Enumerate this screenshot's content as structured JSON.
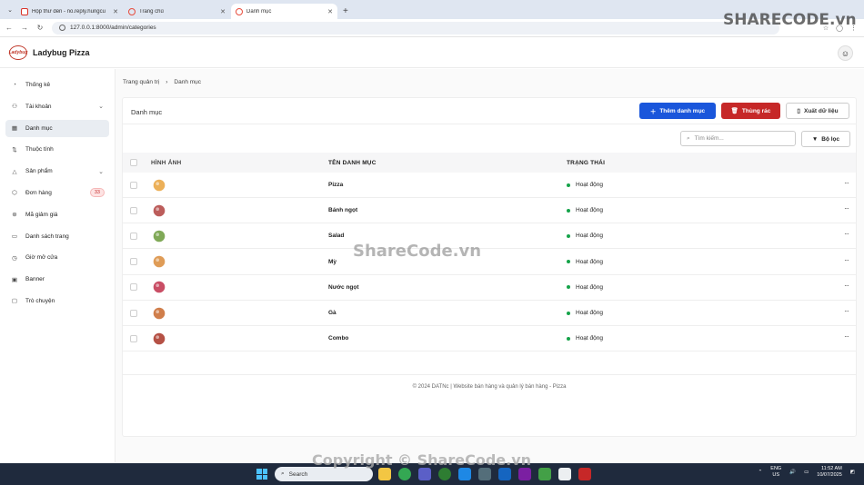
{
  "browser": {
    "tabs": [
      {
        "title": "Hộp thư đến - no.reply.hungcu",
        "favicon_color": "#d93025",
        "active": false
      },
      {
        "title": "Trang chủ",
        "favicon_color": "#e74c3c",
        "active": false
      },
      {
        "title": "Danh mục",
        "favicon_color": "#e74c3c",
        "active": true
      }
    ],
    "new_tab": "+",
    "url": "127.0.0.1:8000/admin/categories"
  },
  "app": {
    "brand": "Ladybug Pizza",
    "logo_text": "Ladybug"
  },
  "sidebar": {
    "items": [
      {
        "label": "Thống kê",
        "icon": "chart-pie-icon",
        "glyph": "◔"
      },
      {
        "label": "Tài khoản",
        "icon": "user-icon",
        "glyph": "⚇",
        "chevron": "⌄"
      },
      {
        "label": "Danh mục",
        "icon": "grid-icon",
        "glyph": "▦",
        "active": true
      },
      {
        "label": "Thuộc tính",
        "icon": "sort-icon",
        "glyph": "⇅"
      },
      {
        "label": "Sản phẩm",
        "icon": "shapes-icon",
        "glyph": "△",
        "chevron": "⌄"
      },
      {
        "label": "Đơn hàng",
        "icon": "box-icon",
        "glyph": "⬡",
        "badge": "33"
      },
      {
        "label": "Mã giảm giá",
        "icon": "discount-icon",
        "glyph": "⊛"
      },
      {
        "label": "Danh sách trang",
        "icon": "pages-icon",
        "glyph": "▭"
      },
      {
        "label": "Giờ mở cửa",
        "icon": "clock-icon",
        "glyph": "◷"
      },
      {
        "label": "Banner",
        "icon": "image-icon",
        "glyph": "▣"
      },
      {
        "label": "Trò chuyện",
        "icon": "chat-icon",
        "glyph": "▢"
      }
    ]
  },
  "breadcrumb": {
    "home": "Trang quản trị",
    "sep": "›",
    "current": "Danh mục"
  },
  "card": {
    "title": "Danh mục",
    "add_label": "Thêm danh mục",
    "trash_label": "Thùng rác",
    "export_label": "Xuất dữ liệu",
    "search_placeholder": "Tìm kiếm...",
    "filter_label": "Bộ lọc"
  },
  "table": {
    "headers": {
      "image": "HÌNH ẢNH",
      "name": "TÊN DANH MỤC",
      "status": "TRẠNG THÁI"
    },
    "rows": [
      {
        "name": "Pizza",
        "status": "Hoạt động",
        "icon": "pizza-slice-icon",
        "color": "#e9a23b"
      },
      {
        "name": "Bánh ngọt",
        "status": "Hoạt động",
        "icon": "cake-icon",
        "color": "#b0413e"
      },
      {
        "name": "Salad",
        "status": "Hoạt động",
        "icon": "salad-icon",
        "color": "#6a9a3a"
      },
      {
        "name": "Mỳ",
        "status": "Hoạt động",
        "icon": "noodle-icon",
        "color": "#d98b3a"
      },
      {
        "name": "Nước ngọt",
        "status": "Hoạt động",
        "icon": "drink-icon",
        "color": "#c02f4a"
      },
      {
        "name": "Gà",
        "status": "Hoạt động",
        "icon": "chicken-icon",
        "color": "#c8672b"
      },
      {
        "name": "Combo",
        "status": "Hoạt động",
        "icon": "combo-icon",
        "color": "#a83225"
      }
    ],
    "more": "···"
  },
  "footer": "© 2024 DATNc | Website bán hàng và quản lý bán hàng - Pizza",
  "taskbar": {
    "search_placeholder": "Search",
    "lang_top": "ENG",
    "lang_bottom": "US",
    "time": "11:52 AM",
    "date": "10/07/2025"
  },
  "watermark": {
    "top": "SHARECODE.vn",
    "center": "ShareCode.vn",
    "bottom": "Copyright © ShareCode.vn"
  },
  "colors": {
    "primary": "#1a56db",
    "danger": "#c62828",
    "active_status": "#16a34a"
  }
}
